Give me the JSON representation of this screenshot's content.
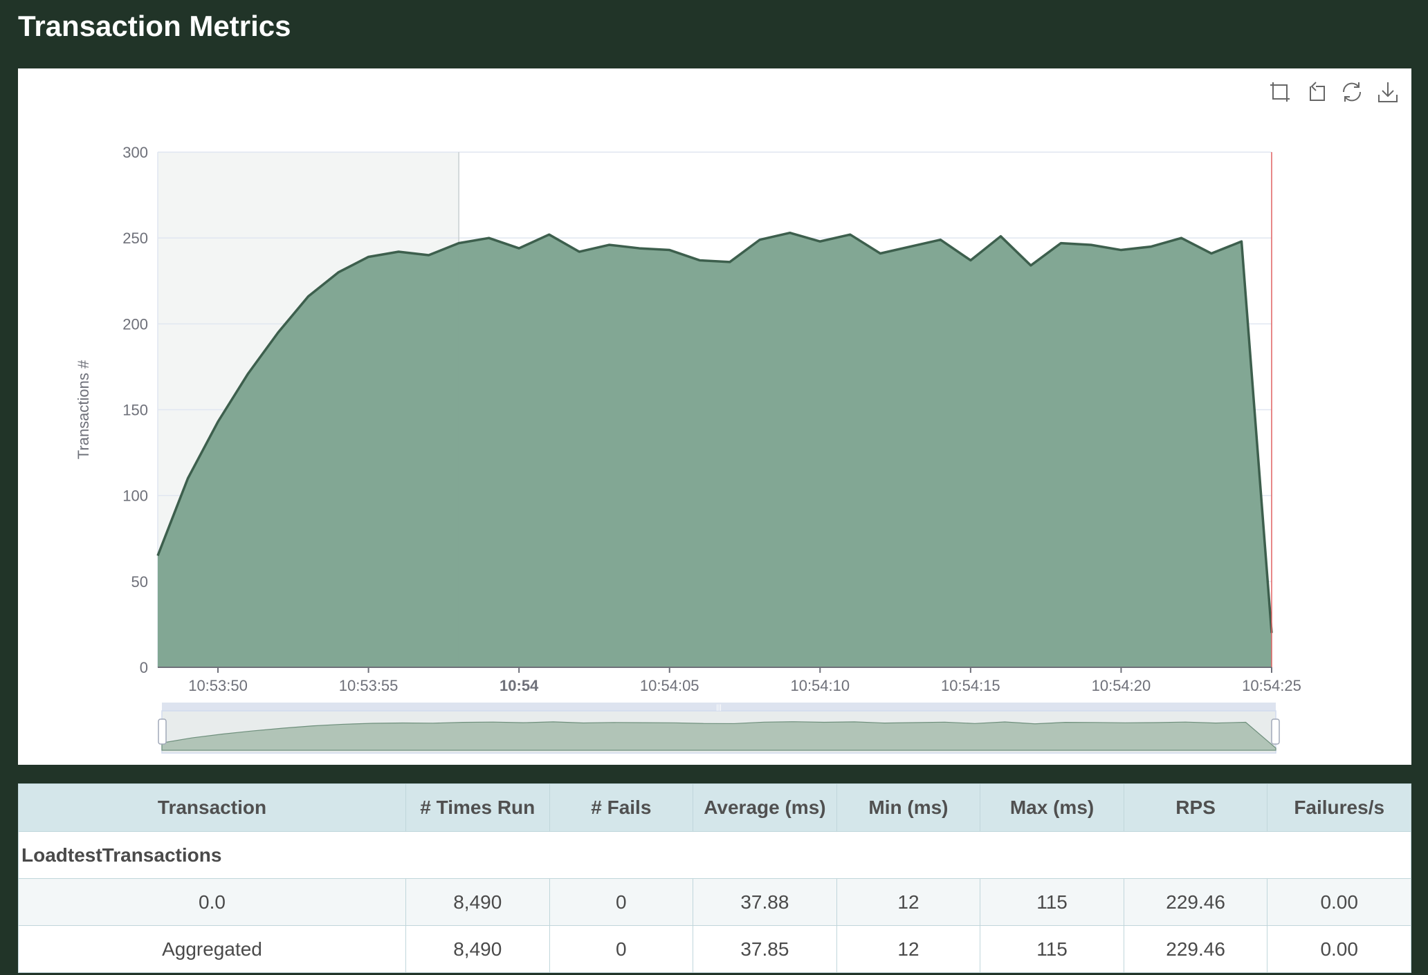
{
  "page": {
    "title": "Transaction Metrics"
  },
  "toolbox": {
    "icons": [
      "zoom-select-icon",
      "zoom-reset-icon",
      "restore-icon",
      "download-icon"
    ]
  },
  "colors": {
    "background": "#213428",
    "series_fill": "#7fa592",
    "series_line": "#3d5f4d",
    "header_bg": "#d4e6ea",
    "marker_line": "#e06060"
  },
  "chart_data": {
    "type": "area",
    "title": "",
    "ylabel": "Transactions #",
    "xlabel": "",
    "ylim": [
      0,
      300
    ],
    "yticks": [
      "0",
      "50",
      "100",
      "150",
      "200",
      "250",
      "300"
    ],
    "xtick_labels": [
      "10:53:50",
      "10:53:55",
      "10:54",
      "10:54:05",
      "10:54:10",
      "10:54:15",
      "10:54:20",
      "10:54:25"
    ],
    "xtick_times": [
      -10,
      -5,
      0,
      5,
      10,
      15,
      20,
      25
    ],
    "xlim_seconds": [
      -12,
      25
    ],
    "grid": true,
    "series": [
      {
        "x": [
          -12,
          -11,
          -10,
          -9,
          -8,
          -7,
          -6,
          -5,
          -4,
          -3,
          -2,
          -1,
          0,
          1,
          2,
          3,
          4,
          5,
          6,
          7,
          8,
          9,
          10,
          11,
          12,
          13,
          14,
          15,
          16,
          17,
          18,
          19,
          20,
          21,
          22,
          23,
          24,
          25
        ],
        "values": [
          65,
          110,
          143,
          171,
          195,
          216,
          230,
          239,
          242,
          240,
          247,
          250,
          244,
          252,
          242,
          246,
          244,
          243,
          237,
          236,
          249,
          253,
          248,
          252,
          241,
          245,
          249,
          237,
          251,
          234,
          247,
          246,
          243,
          245,
          250,
          241,
          248,
          20
        ]
      }
    ],
    "shaded_region_seconds": [
      -12,
      -2
    ],
    "marker_seconds": 25,
    "bold_tick": "10:54"
  },
  "table": {
    "headers": [
      "Transaction",
      "# Times Run",
      "# Fails",
      "Average (ms)",
      "Min (ms)",
      "Max (ms)",
      "RPS",
      "Failures/s"
    ],
    "group_label": "LoadtestTransactions",
    "rows": [
      [
        "0.0",
        "8,490",
        "0",
        "37.88",
        "12",
        "115",
        "229.46",
        "0.00"
      ],
      [
        "Aggregated",
        "8,490",
        "0",
        "37.85",
        "12",
        "115",
        "229.46",
        "0.00"
      ]
    ]
  }
}
